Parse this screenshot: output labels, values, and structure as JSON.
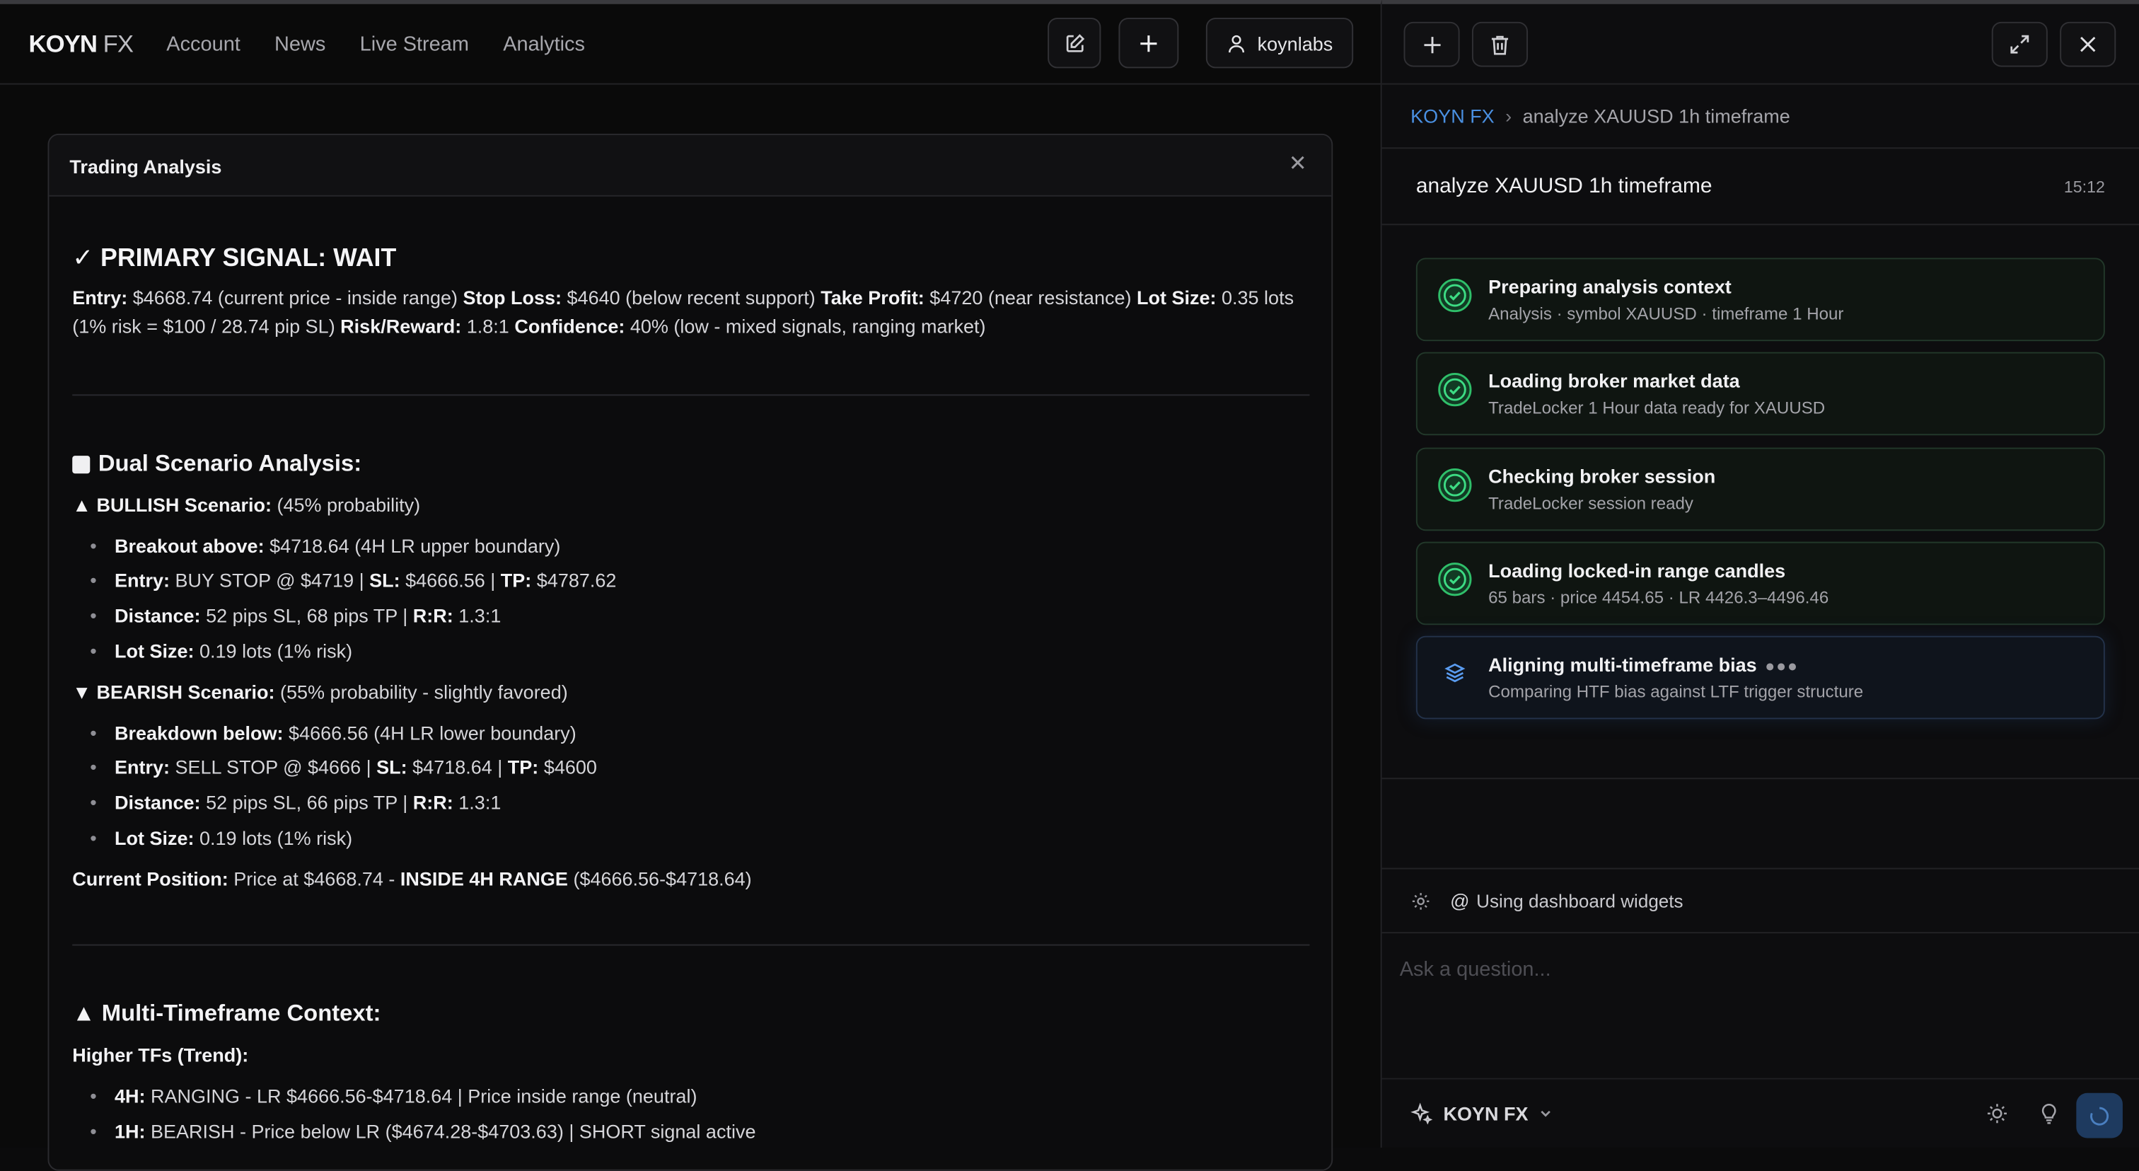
{
  "app": {
    "logo_bold": "KOYN",
    "logo_light": " FX",
    "nav": [
      "Account",
      "News",
      "Live Stream",
      "Analytics"
    ],
    "user": "koynlabs"
  },
  "card": {
    "title": "Trading Analysis",
    "primary_signal": "✓ PRIMARY SIGNAL: WAIT",
    "entry_label": "Entry:",
    "entry_value": " $4668.74 (current price - inside range) ",
    "sl_label": "Stop Loss:",
    "sl_value": " $4640 (below recent support) ",
    "tp_label": "Take Profit:",
    "tp_value": " $4720 (near resistance) ",
    "lot_label": "Lot Size:",
    "lot_value": " 0.35 lots (1% risk = $100 / 28.74 pip SL) ",
    "rr_label": "Risk/Reward:",
    "rr_value": " 1.8:1 ",
    "conf_label": "Confidence:",
    "conf_value": " 40% (low - mixed signals, ranging market)",
    "dual_heading": "Dual Scenario Analysis:",
    "bull_label": "▲ BULLISH Scenario:",
    "bull_prob": " (45% probability)",
    "bull_items": [
      {
        "label": "Breakout above:",
        "value": " $4718.64 (4H LR upper boundary)"
      },
      {
        "label": "Entry:",
        "value": " BUY STOP @ $4719 | ",
        "l2": "SL:",
        "v2": " $4666.56 | ",
        "l3": "TP:",
        "v3": " $4787.62"
      },
      {
        "label": "Distance:",
        "value": " 52 pips SL, 68 pips TP | ",
        "l2": "R:R:",
        "v2": " 1.3:1"
      },
      {
        "label": "Lot Size:",
        "value": " 0.19 lots (1% risk)"
      }
    ],
    "bear_label": "▼ BEARISH Scenario:",
    "bear_prob": " (55% probability - slightly favored)",
    "bear_items": [
      {
        "label": "Breakdown below:",
        "value": " $4666.56 (4H LR lower boundary)"
      },
      {
        "label": "Entry:",
        "value": " SELL STOP @ $4666 | ",
        "l2": "SL:",
        "v2": " $4718.64 | ",
        "l3": "TP:",
        "v3": " $4600"
      },
      {
        "label": "Distance:",
        "value": " 52 pips SL, 66 pips TP | ",
        "l2": "R:R:",
        "v2": " 1.3:1"
      },
      {
        "label": "Lot Size:",
        "value": " 0.19 lots (1% risk)"
      }
    ],
    "pos_label": "Current Position:",
    "pos_value": " Price at $4668.74 - ",
    "pos_bold": "INSIDE 4H RANGE",
    "pos_tail": " ($4666.56-$4718.64)",
    "mtf_heading": "▲ Multi-Timeframe Context:",
    "htf_label": "Higher TFs (Trend):",
    "mtf_items": [
      {
        "label": "4H:",
        "value": " RANGING - LR $4666.56-$4718.64 | Price inside range (neutral)"
      },
      {
        "label": "1H:",
        "value": " BEARISH - Price below LR ($4674.28-$4703.63) | SHORT signal active"
      }
    ]
  },
  "panel": {
    "crumb_brand": "KOYN FX",
    "crumb_sep": "›",
    "crumb_current": "analyze XAUUSD 1h timeframe",
    "query": "analyze XAUUSD 1h timeframe",
    "time": "15:12",
    "steps": [
      {
        "title": "Preparing analysis context",
        "desc": "Analysis · symbol XAUUSD · timeframe 1 Hour",
        "status": "done"
      },
      {
        "title": "Loading broker market data",
        "desc": "TradeLocker 1 Hour data ready for XAUUSD",
        "status": "done"
      },
      {
        "title": "Checking broker session",
        "desc": "TradeLocker session ready",
        "status": "done"
      },
      {
        "title": "Loading locked-in range candles",
        "desc": "65 bars · price 4454.65 · LR 4426.3–4496.46",
        "status": "done"
      },
      {
        "title": "Aligning multi-timeframe bias",
        "desc": "Comparing HTF bias against LTF trigger structure",
        "status": "active"
      }
    ],
    "context": "Using dashboard widgets",
    "ask_placeholder": "Ask a question...",
    "model": "KOYN FX"
  },
  "colors": {
    "accent": "#4a90e2",
    "success": "#3ddc84",
    "background": "#0a0a0a"
  }
}
